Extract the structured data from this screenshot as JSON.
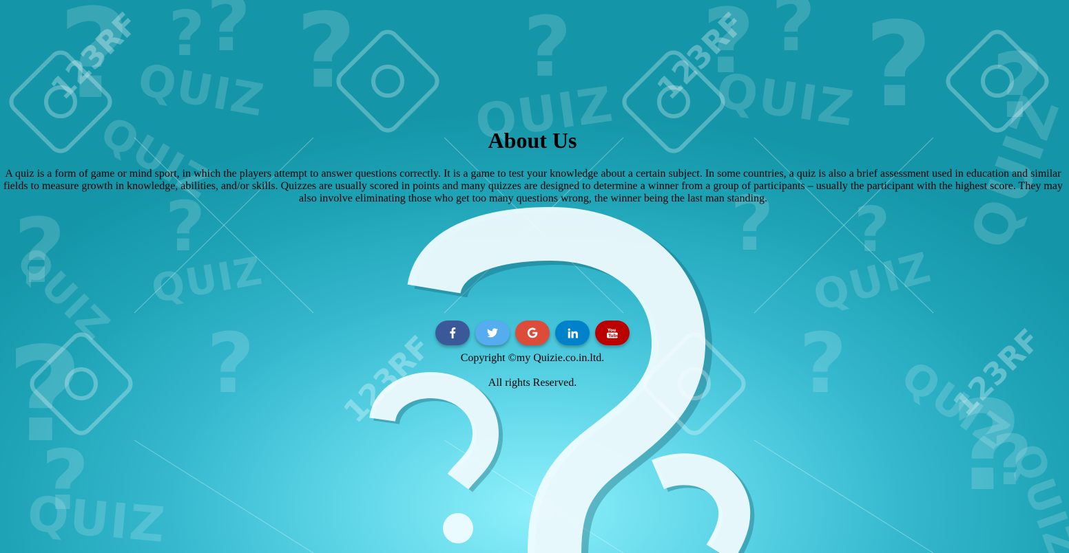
{
  "about": {
    "title": "About Us",
    "text": "A quiz is a form of game or mind sport, in which the players attempt to answer questions correctly. It is a game to test your knowledge about a certain subject. In some countries, a quiz is also a brief assessment used in education and similar fields to measure growth in knowledge, abilities, and/or skills. Quizzes are usually scored in points and many quizzes are designed to determine a winner from a group of participants – usually the participant with the highest score. They may also involve eliminating those who get too many questions wrong, the winner being the last man standing."
  },
  "social": [
    {
      "name": "facebook",
      "icon": "facebook-icon",
      "color": "#3b5998"
    },
    {
      "name": "twitter",
      "icon": "twitter-icon",
      "color": "#55acee"
    },
    {
      "name": "google",
      "icon": "google-icon",
      "color": "#dd4b39"
    },
    {
      "name": "linkedin",
      "icon": "linkedin-icon",
      "color": "#0082ca"
    },
    {
      "name": "youtube",
      "icon": "youtube-icon",
      "color": "#bb0000"
    }
  ],
  "footer": {
    "copyright": "Copyright ©my Quizie.co.in.ltd.",
    "rights": "All rights Reserved."
  },
  "background": {
    "watermark_text": "123RF",
    "pattern_word": "QUIZ",
    "colors": {
      "center": "#8ef0fb",
      "edge": "#1496a8"
    }
  }
}
